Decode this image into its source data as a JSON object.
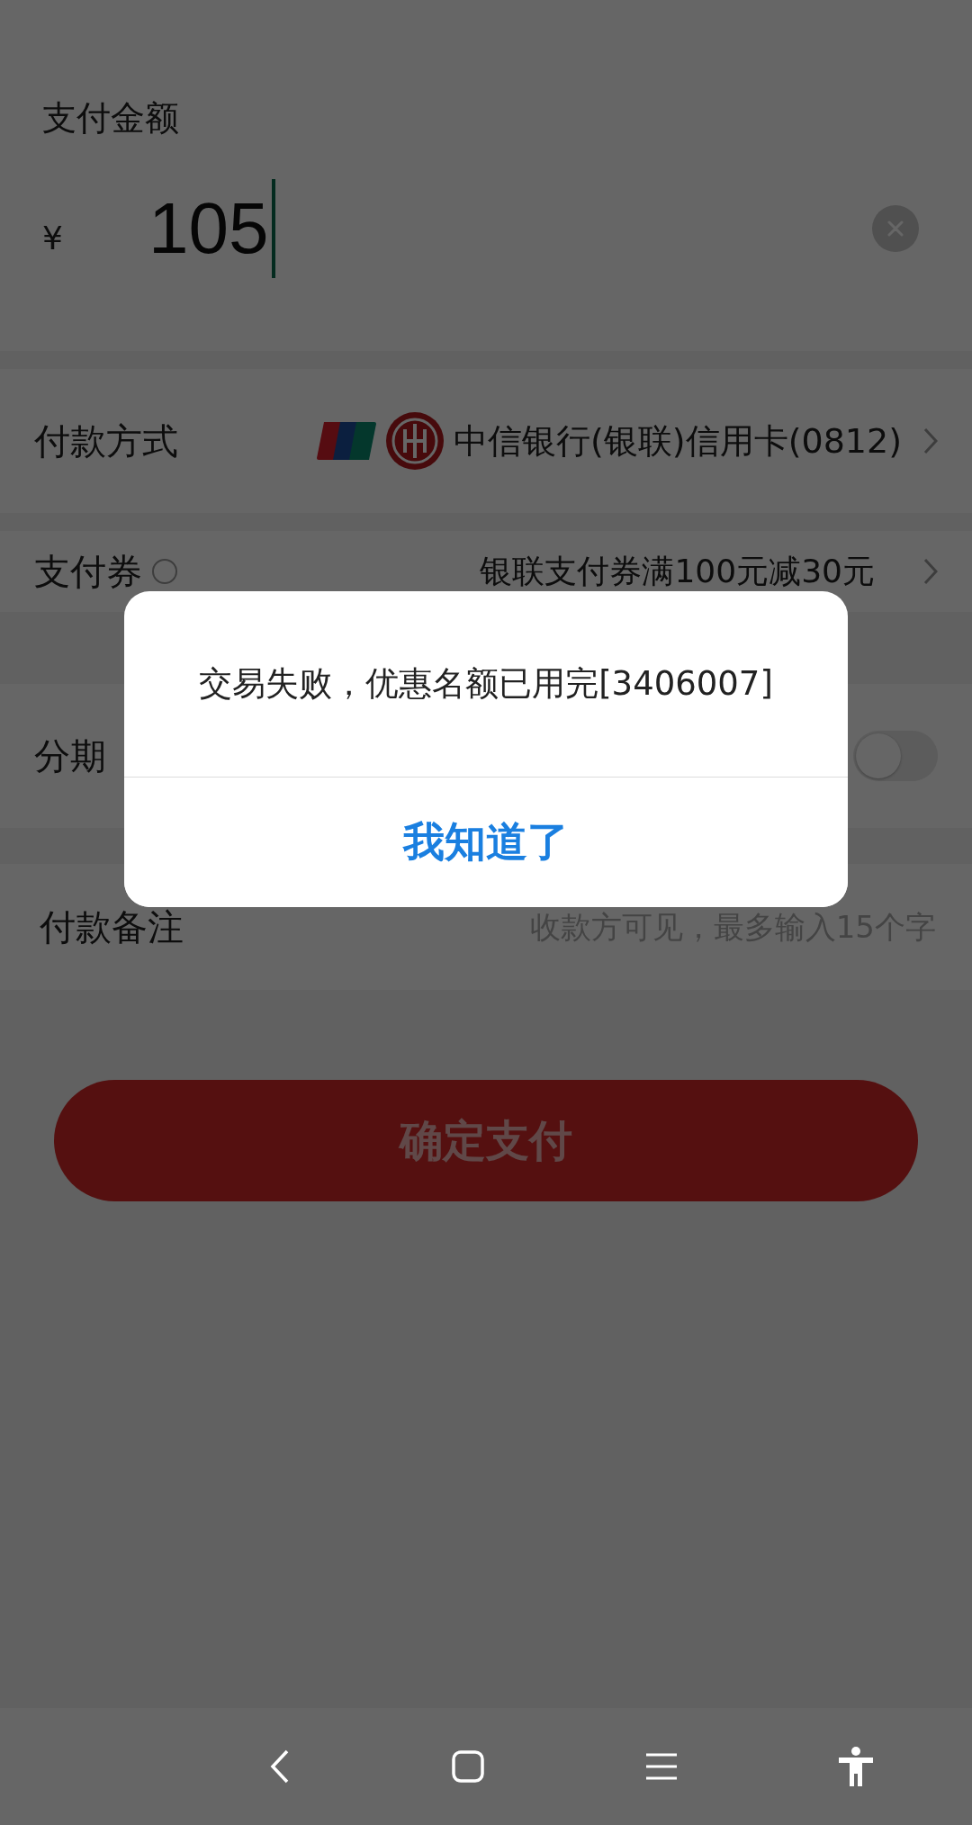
{
  "amount": {
    "label": "支付金额",
    "currency": "¥",
    "value": "105"
  },
  "payment_method": {
    "label": "付款方式",
    "card": "中信银行(银联)信用卡(0812)"
  },
  "coupon": {
    "label": "支付券",
    "value": "银联支付券满100元减30元"
  },
  "installment": {
    "label": "分期",
    "on": false
  },
  "note": {
    "label": "付款备注",
    "placeholder": "收款方可见，最多输入15个字"
  },
  "confirm_button": "确定支付",
  "dialog": {
    "message": "交易失败，优惠名额已用完[3406007]",
    "button": "我知道了"
  }
}
